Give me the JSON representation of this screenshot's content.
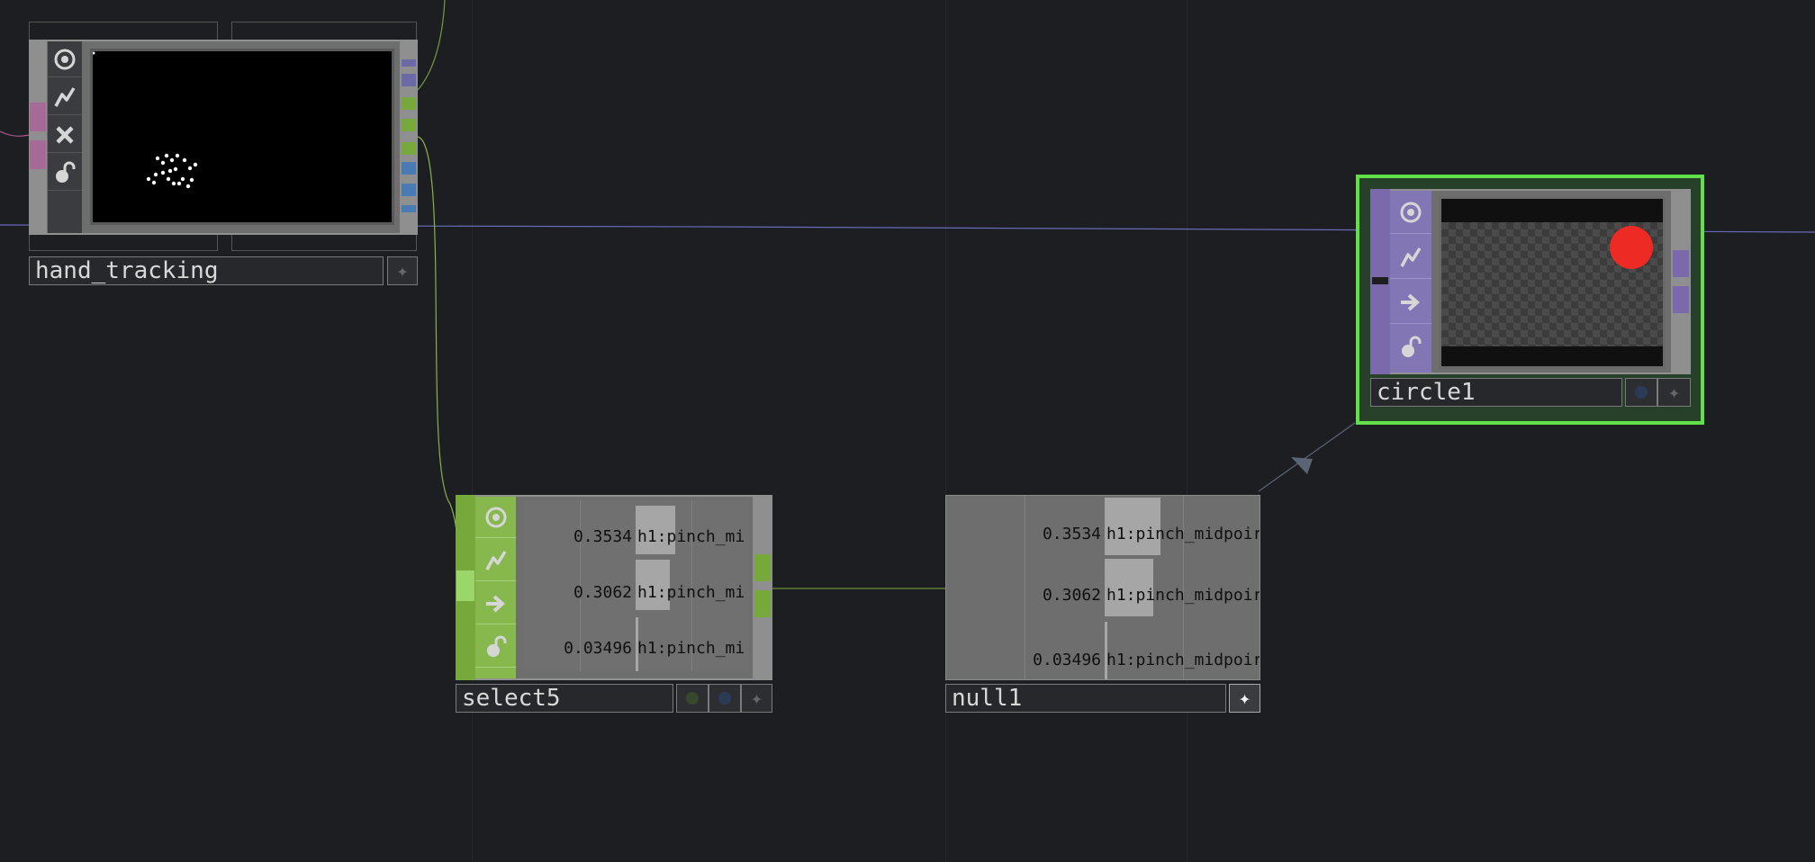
{
  "colors": {
    "canvas_bg": "#1c1e22",
    "top_accent": "#9aa0a6",
    "chop_accent": "#76a83c",
    "chop_accent_light": "#9bd66a",
    "sop_accent": "#7a6aac",
    "selection": "#62e04a",
    "circle_fill": "#ee2a24"
  },
  "icons": [
    "target-icon",
    "lightning-icon",
    "close-icon",
    "lock-icon",
    "arrow-right-icon",
    "star-icon",
    "dot-icon"
  ],
  "nodes": {
    "hand_tracking": {
      "name": "hand_tracking"
    },
    "circle1": {
      "name": "circle1"
    },
    "select5": {
      "name": "select5",
      "channels": [
        {
          "value": "0.3534",
          "name": "h1:pinch_mi"
        },
        {
          "value": "0.3062",
          "name": "h1:pinch_mi"
        },
        {
          "value": "0.03496",
          "name": "h1:pinch_mi"
        }
      ]
    },
    "null1": {
      "name": "null1",
      "channels": [
        {
          "value": "0.3534",
          "name": "h1:pinch_midpoir"
        },
        {
          "value": "0.3062",
          "name": "h1:pinch_midpoir"
        },
        {
          "value": "0.03496",
          "name": "h1:pinch_midpoir"
        }
      ]
    }
  }
}
